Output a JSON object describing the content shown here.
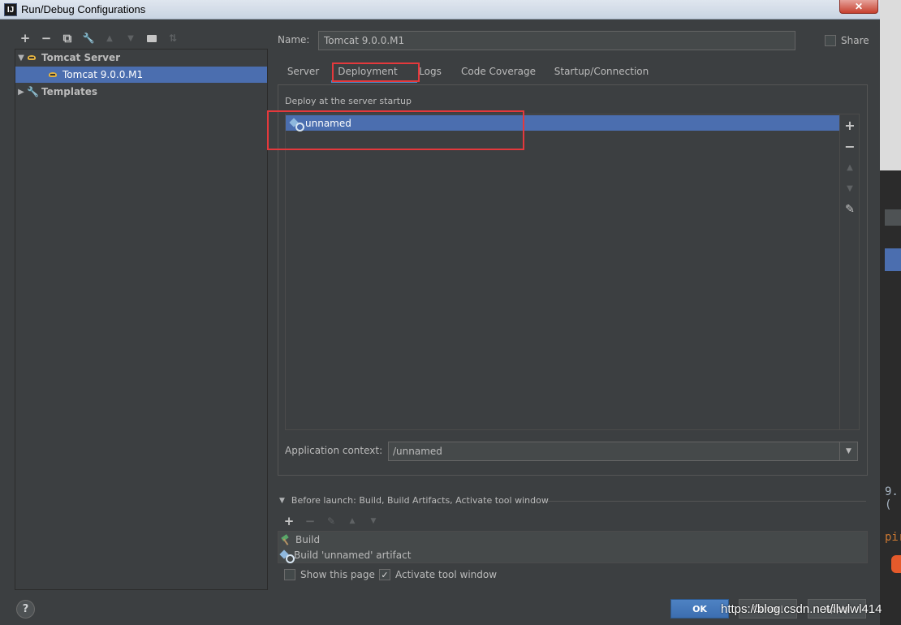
{
  "window": {
    "title": "Run/Debug Configurations",
    "icon_text": "IJ",
    "close_label": "✕"
  },
  "left_toolbar": [
    {
      "icon": "plus-icon",
      "glyph": "+"
    },
    {
      "icon": "minus-icon",
      "glyph": "−"
    },
    {
      "icon": "copy-icon",
      "glyph": "⧉"
    },
    {
      "icon": "wrench-icon",
      "glyph": "🔧"
    },
    {
      "icon": "arrow-up-icon",
      "glyph": "▲"
    },
    {
      "icon": "arrow-down-icon",
      "glyph": "▼"
    },
    {
      "icon": "new-folder-icon",
      "glyph": "▆"
    },
    {
      "icon": "sort-icon",
      "glyph": "⇅"
    }
  ],
  "tree": {
    "group": "Tomcat Server",
    "config": "Tomcat 9.0.0.M1",
    "templates": "Templates"
  },
  "name": {
    "label": "Name:",
    "value": "Tomcat 9.0.0.M1"
  },
  "share": {
    "label": "Share",
    "checked": false
  },
  "tabs": [
    "Server",
    "Deployment",
    "Logs",
    "Code Coverage",
    "Startup/Connection"
  ],
  "active_tab": "Deployment",
  "deployment": {
    "section_label": "Deploy at the server startup",
    "items": [
      {
        "name": "unnamed",
        "icon": "artifact-icon"
      }
    ],
    "side_buttons": [
      {
        "icon": "add-icon",
        "glyph": "+"
      },
      {
        "icon": "remove-icon",
        "glyph": "−"
      },
      {
        "icon": "move-up-icon",
        "glyph": "▲"
      },
      {
        "icon": "move-down-icon",
        "glyph": "▼"
      },
      {
        "icon": "edit-icon",
        "glyph": "✎"
      }
    ],
    "app_context_label": "Application context:",
    "app_context_value": "/unnamed"
  },
  "before_launch": {
    "header": "Before launch: Build, Build Artifacts, Activate tool window",
    "toolbar": [
      {
        "icon": "add-icon",
        "glyph": "+"
      },
      {
        "icon": "remove-icon",
        "glyph": "−"
      },
      {
        "icon": "edit-icon",
        "glyph": "✎"
      },
      {
        "icon": "move-up-icon",
        "glyph": "▲"
      },
      {
        "icon": "move-down-icon",
        "glyph": "▼"
      }
    ],
    "items": [
      {
        "label": "Build",
        "icon": "hammer-icon"
      },
      {
        "label": "Build 'unnamed' artifact",
        "icon": "artifact-icon"
      }
    ],
    "show_this_page": {
      "label": "Show this page",
      "checked": false
    },
    "activate_tool_window": {
      "label": "Activate tool window",
      "checked": true
    }
  },
  "buttons": {
    "ok": "OK",
    "cancel": "Cancel",
    "apply": "Apply",
    "help": "?"
  },
  "watermark": "https://blog.csdn.net/llwlwl414",
  "outside_text": {
    "line1": "9. (",
    "line2": "pir"
  },
  "colors": {
    "selection": "#4b6eaf",
    "highlight_box": "#e4393c",
    "tab_underline": "#4a88c7"
  }
}
